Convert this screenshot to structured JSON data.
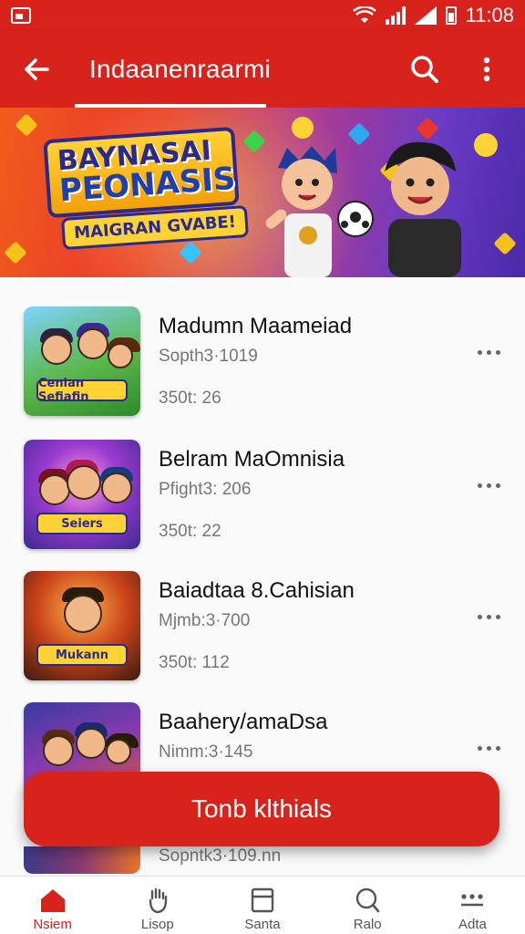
{
  "status_bar": {
    "time": "11:08"
  },
  "app_bar": {
    "title": "Indaanenraarmi",
    "icons": {
      "back": "arrow-left-icon",
      "search": "search-icon",
      "more": "more-vertical-icon"
    }
  },
  "banner": {
    "title_line1": "BAYNASAI",
    "title_line2": "PEONASIS",
    "subtitle": "MAIGRAN GVABE!"
  },
  "games": [
    {
      "title": "Madumn Maameiad",
      "meta": "Sopth3·1019",
      "stat": "350t: 26",
      "thumb_label": "Cenian Sefiafin"
    },
    {
      "title": "Belram MaOmnisia",
      "meta": "Pfight3: 206",
      "stat": "350t: 22",
      "thumb_label": "Seiers"
    },
    {
      "title": "Baiadtaa 8.Cahisian",
      "meta": "Mjmb:3·700",
      "stat": "350t: 112",
      "thumb_label": "Mukann"
    },
    {
      "title": "Baahery/amaDsa",
      "meta": "Nimm:3·145",
      "stat": "",
      "thumb_label": ""
    }
  ],
  "peek_item": {
    "meta": "Sopntk3·109.nn"
  },
  "fab": {
    "label": "Tonb klthials"
  },
  "bottom_nav": [
    {
      "label": "Nsiem",
      "icon": "home-icon",
      "active": true
    },
    {
      "label": "Lisop",
      "icon": "hand-icon",
      "active": false
    },
    {
      "label": "Santa",
      "icon": "square-icon",
      "active": false
    },
    {
      "label": "Ralo",
      "icon": "chat-icon",
      "active": false
    },
    {
      "label": "Adta",
      "icon": "more-horizontal-icon",
      "active": false
    }
  ],
  "colors": {
    "primary": "#d8231d",
    "background": "#fafafa",
    "text": "#111111",
    "muted": "#777777"
  }
}
